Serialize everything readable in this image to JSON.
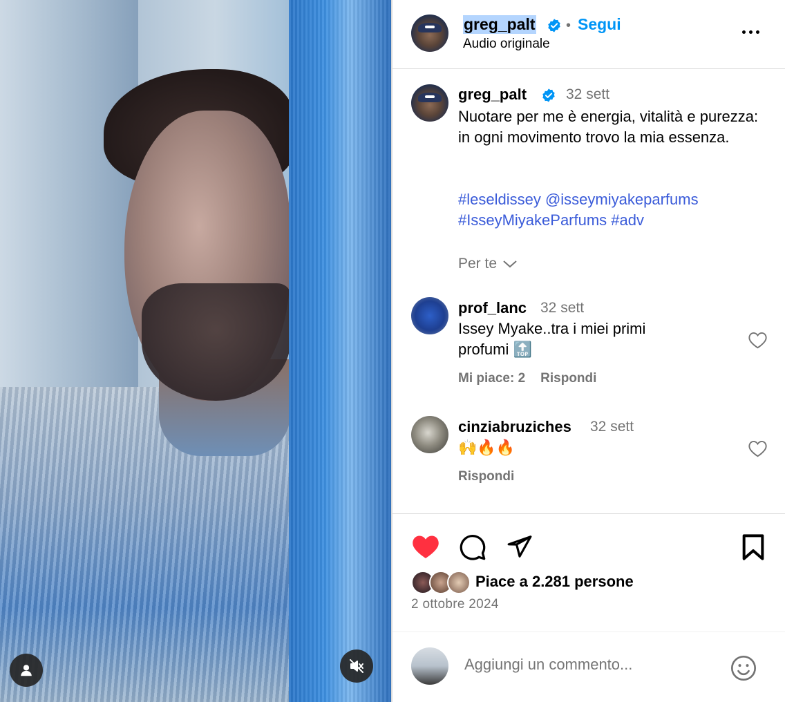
{
  "post": {
    "author": "greg_palt",
    "follow_label": "Segui",
    "header_dot": "•",
    "audio_label": "Audio originale",
    "caption_time": "32 sett",
    "caption_text": "Nuotare per me è energia, vitalità e purezza: in ogni movimento trovo la mia essenza.",
    "tags_line1": "#leseldissey @isseymiyakeparfums",
    "tags_line2": "#IsseyMiyakeParfums #adv",
    "see_for_you": "Per te",
    "likes_text": "Piace a 2.281 persone",
    "date": "2 ottobre 2024",
    "liked": true
  },
  "comments": [
    {
      "user": "prof_lanc",
      "time": "32 sett",
      "text_line1": "Issey Myake..tra i miei primi",
      "text_line2": "profumi 🔝",
      "likes_label": "Mi piace: 2",
      "reply_label": "Rispondi"
    },
    {
      "user": "cinziabruziches",
      "time": "32 sett",
      "text_line1": "🙌🔥🔥",
      "reply_label": "Rispondi"
    }
  ],
  "add_comment": {
    "placeholder": "Aggiungi un commento..."
  },
  "icons": {
    "verified": "verified-badge-icon",
    "more": "more-options-icon",
    "like": "heart-icon",
    "comment": "comment-icon",
    "share": "send-icon",
    "save": "bookmark-icon",
    "mute": "muted-speaker-icon",
    "tagged": "person-icon",
    "emoji": "smiley-icon"
  },
  "colors": {
    "accent": "#0095f6",
    "link": "#3a5bd9",
    "like_red": "#ff3040",
    "secondary_text": "#737373"
  }
}
